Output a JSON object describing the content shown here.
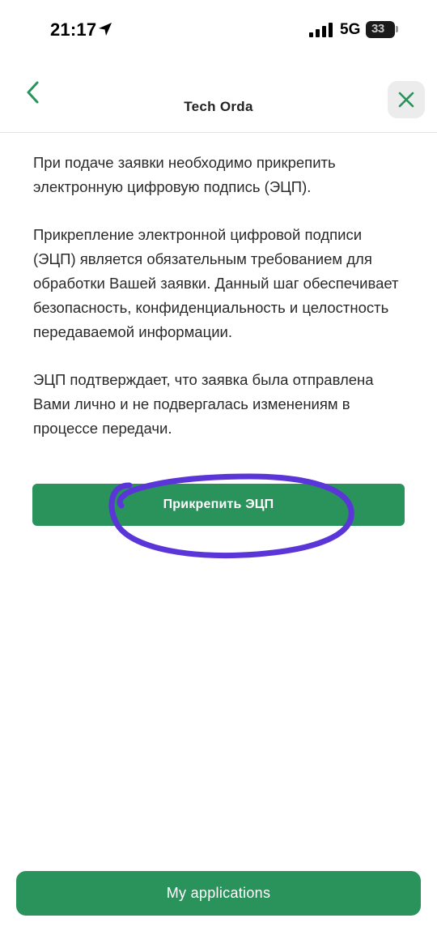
{
  "status_bar": {
    "time": "21:17",
    "location_icon": "location-arrow-icon",
    "signal_icon": "cellular-signal-icon",
    "network": "5G",
    "battery_level": "33"
  },
  "header": {
    "title": "Tech Orda",
    "back_icon": "chevron-left-icon",
    "close_icon": "close-icon"
  },
  "content": {
    "paragraphs": [
      "При подаче заявки необходимо прикрепить электронную цифровую подпись (ЭЦП).",
      "Прикрепление электронной цифровой подписи (ЭЦП) является обязательным требованием для обработки Вашей заявки. Данный шаг обеспечивает безопасность, конфиденциальность и целостность передаваемой информации.",
      "ЭЦП подтверждает, что заявка была отправлена Вами лично и не подвергалась изменениям в процессе передачи."
    ],
    "attach_button_label": "Прикрепить ЭЦП"
  },
  "footer": {
    "applications_button_label": "My applications"
  },
  "colors": {
    "accent": "#2a925b",
    "annotation": "#5a35d8"
  }
}
